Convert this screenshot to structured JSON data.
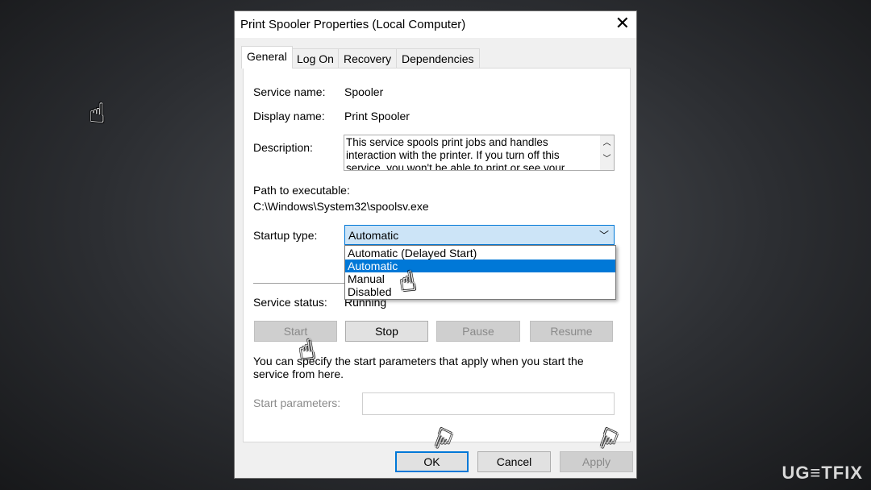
{
  "window": {
    "title": "Print Spooler Properties (Local Computer)",
    "close_icon": "close-icon"
  },
  "tabs": [
    {
      "label": "General",
      "active": true
    },
    {
      "label": "Log On"
    },
    {
      "label": "Recovery"
    },
    {
      "label": "Dependencies"
    }
  ],
  "general": {
    "service_name_label": "Service name:",
    "service_name": "Spooler",
    "display_name_label": "Display name:",
    "display_name": "Print Spooler",
    "description_label": "Description:",
    "description": "This service spools print jobs and handles interaction with the printer.  If you turn off this service, you won't be able to print or see your printers.",
    "path_label": "Path to executable:",
    "path": "C:\\Windows\\System32\\spoolsv.exe",
    "startup_type_label": "Startup type:",
    "startup_type": "Automatic",
    "startup_options": [
      "Automatic (Delayed Start)",
      "Automatic",
      "Manual",
      "Disabled"
    ],
    "highlighted_option": "Automatic",
    "service_status_label": "Service status:",
    "service_status": "Running",
    "buttons": {
      "start": "Start",
      "stop": "Stop",
      "pause": "Pause",
      "resume": "Resume"
    },
    "hint": "You can specify the start parameters that apply when you start the service from here.",
    "start_params_label": "Start parameters:",
    "start_params_value": ""
  },
  "footer": {
    "ok": "OK",
    "cancel": "Cancel",
    "apply": "Apply"
  },
  "watermark": "UG≡TFIX",
  "colors": {
    "accent": "#0078d7",
    "selection": "#0078d7",
    "combo_bg": "#cce4f7"
  }
}
